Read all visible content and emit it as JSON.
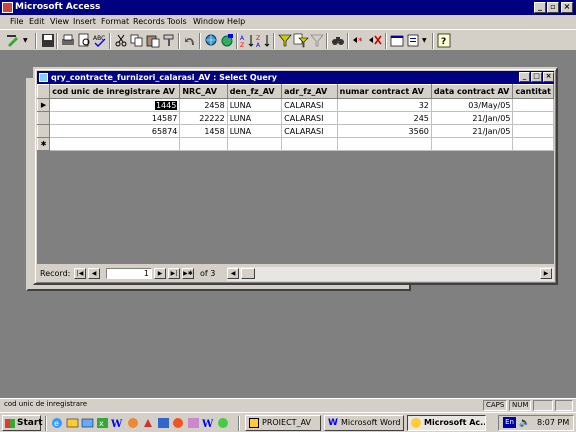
{
  "app": {
    "title": "Microsoft Access"
  },
  "menu": [
    "File",
    "Edit",
    "View",
    "Insert",
    "Format",
    "Records",
    "Tools",
    "Window",
    "Help"
  ],
  "toolbar": {
    "icons": [
      "view-design-icon",
      "save-icon",
      "print-icon",
      "print-preview-icon",
      "spelling-icon",
      "cut-icon",
      "copy-icon",
      "paste-icon",
      "format-painter-icon",
      "undo-icon",
      "insert-hyperlink-icon",
      "web-toolbar-icon",
      "sort-ascending-icon",
      "sort-descending-icon",
      "filter-by-selection-icon",
      "filter-by-form-icon",
      "apply-filter-icon",
      "find-icon",
      "new-record-icon",
      "delete-record-icon",
      "database-window-icon",
      "new-object-icon",
      "help-icon"
    ]
  },
  "query_window": {
    "title": "qry_contracte_furnizori_calarasi_AV : Select Query",
    "columns": [
      "cod unic de inregistrare AV",
      "NRC_AV",
      "den_fz_AV",
      "adr_fz_AV",
      "numar contract AV",
      "data contract AV",
      "cantitat"
    ],
    "rows": [
      [
        "1445",
        "2458",
        "LUNA",
        "CALARASI",
        "32",
        "03/May/05",
        ""
      ],
      [
        "14587",
        "22222",
        "LUNA",
        "CALARASI",
        "245",
        "21/Jan/05",
        ""
      ],
      [
        "65874",
        "1458",
        "LUNA",
        "CALARASI",
        "3560",
        "21/Jan/05",
        ""
      ]
    ],
    "navigator": {
      "label": "Record:",
      "current": "1",
      "of_text": "of  3"
    }
  },
  "status": {
    "text": "cod unic de inregistrare",
    "caps": "CAPS",
    "num": "NUM"
  },
  "taskbar": {
    "start": "Start",
    "tasks": [
      "PROIECT_AV",
      "Microsoft Word ...",
      "Microsoft Ac..."
    ],
    "lang": "En",
    "clock": "8:07 PM"
  }
}
